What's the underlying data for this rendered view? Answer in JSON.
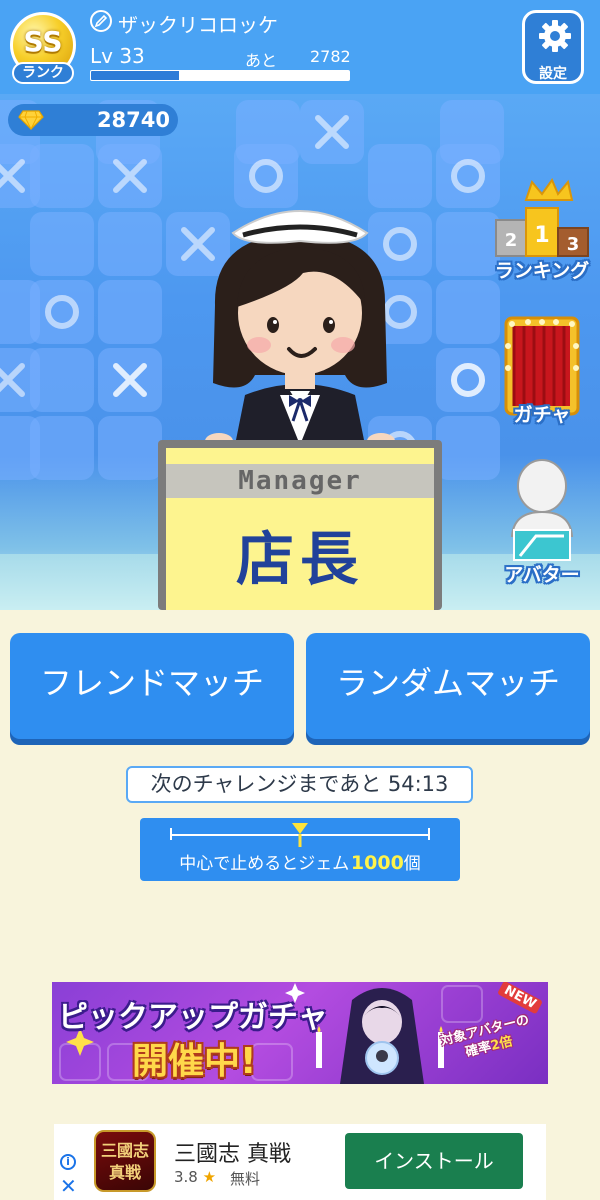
{
  "header": {
    "rank_letters": "SS",
    "rank_label": "ランク",
    "player_name": "ザックリコロッケ",
    "level_text": "Lv 33",
    "next_label": "あと",
    "next_value": "2782",
    "xp_progress": 0.34,
    "settings_label": "設定"
  },
  "currency": {
    "gems": "28740",
    "gem_color": "#ffd23a"
  },
  "side_menu": {
    "ranking": {
      "label": "ランキング",
      "places": [
        "2",
        "1",
        "3"
      ]
    },
    "gacha": {
      "label": "ガチャ"
    },
    "avatar": {
      "label": "アバター"
    }
  },
  "nameplate": {
    "role": "Manager",
    "title": "店長"
  },
  "match": {
    "friend_label": "フレンドマッチ",
    "random_label": "ランダムマッチ"
  },
  "challenge": {
    "timer_text": "次のチャレンジまであと 54:13",
    "reward_prefix": "中心で止めるとジェム",
    "reward_amount": "1000",
    "reward_suffix": "個"
  },
  "banner": {
    "title": "ピックアップガチャ",
    "subtitle": "開催中!",
    "badge": "NEW",
    "note_line1": "対象アバターの",
    "note_line2_prefix": "確率",
    "note_line2_highlight": "2倍"
  },
  "ad": {
    "app_icon_text": "三國志",
    "app_icon_sub": "真戦",
    "app_name": "三國志 真戦",
    "rating": "3.8",
    "price": "無料",
    "install_label": "インストール"
  },
  "colors": {
    "header_blue": "#4aa3f4",
    "button_blue": "#2f8ef0",
    "cream_background": "#f8f4dc",
    "plate_yellow": "#fdf48f",
    "plate_text_navy": "#21429a",
    "install_green": "#1a7f4f"
  }
}
